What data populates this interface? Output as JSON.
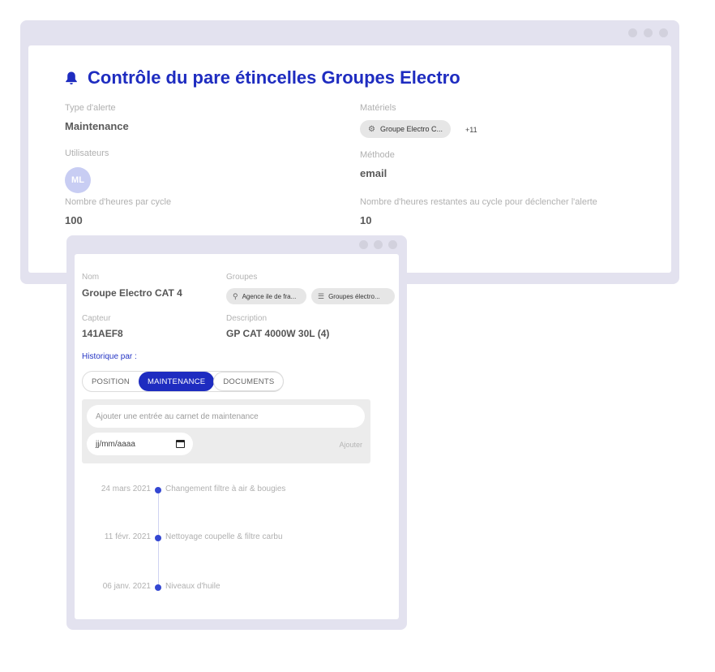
{
  "alert": {
    "title": "Contrôle du pare étincelles Groupes Electro",
    "type_label": "Type d'alerte",
    "type_value": "Maintenance",
    "materials_label": "Matériels",
    "material_chip": "Groupe Electro C...",
    "material_more": "+11",
    "users_label": "Utilisateurs",
    "user_initials": "ML",
    "method_label": "Méthode",
    "method_value": "email",
    "hours_label": "Nombre d'heures par cycle",
    "hours_value": "100",
    "remaining_label": "Nombre d'heures restantes au cycle pour déclencher l'alerte",
    "remaining_value": "10"
  },
  "equipment": {
    "name_label": "Nom",
    "name_value": "Groupe Electro CAT 4",
    "groups_label": "Groupes",
    "group_chips": [
      "Agence ile de fra...",
      "Groupes électro..."
    ],
    "sensor_label": "Capteur",
    "sensor_value": "141AEF8",
    "description_label": "Description",
    "description_value": "GP CAT 4000W 30L (4)",
    "history_label": "Historique par :",
    "tabs": [
      {
        "label": "POSITION",
        "active": false
      },
      {
        "label": "MAINTENANCE",
        "active": true
      },
      {
        "label": "DOCUMENTS",
        "active": false
      }
    ],
    "entry_placeholder": "Ajouter une entrée au carnet de maintenance",
    "date_placeholder": "jj/mm/aaaa",
    "add_label": "Ajouter",
    "timeline": [
      {
        "date": "24 mars 2021",
        "text": "Changement filtre à air & bougies"
      },
      {
        "date": "11 févr. 2021",
        "text": "Nettoyage coupelle & filtre carbu"
      },
      {
        "date": "06 janv. 2021",
        "text": "Niveaux d'huile"
      }
    ]
  },
  "icons": {
    "alert": "bell-icon",
    "material": "generator-icon",
    "location": "location-pin-icon",
    "group": "list-icon",
    "date": "calendar-icon"
  },
  "colors": {
    "accent": "#1e2cc0",
    "window_frame": "#e3e2ef",
    "avatar": "#c8cdf3",
    "timeline_dot": "#3447d2"
  }
}
